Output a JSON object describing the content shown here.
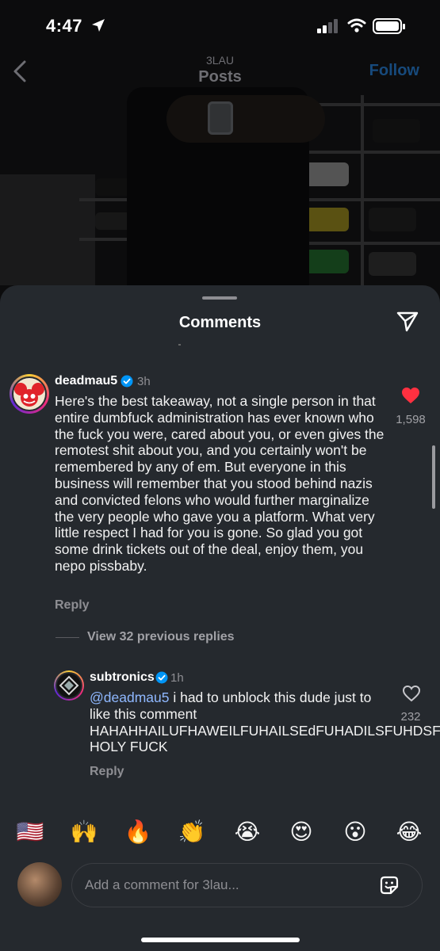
{
  "status_bar": {
    "time": "4:47"
  },
  "header": {
    "username": "3LAU",
    "title": "Posts",
    "follow_label": "Follow"
  },
  "sheet": {
    "title": "Comments"
  },
  "comments": [
    {
      "username": "deadmau5",
      "verified": true,
      "time": "3h",
      "text": "Here's the best takeaway, not a single person in that entire dumbfuck administration has ever known who the fuck you were, cared about you, or even gives the remotest shit about you, and you certainly won't be remembered by any of em. But everyone in this business will remember that you stood behind nazis and convicted felons who would further marginalize the very people who gave you a platform. What very little respect I had for you is gone.  So glad you got some drink tickets out of the deal, enjoy them, you nepo pissbaby.",
      "reply_label": "Reply",
      "likes": "1,598",
      "liked": true,
      "view_replies_label": "View 32 previous replies"
    },
    {
      "username": "subtronics",
      "verified": true,
      "time": "1h",
      "mention": "@deadmau5",
      "text": " i had to unblock this dude just to like this comment HAHAHHAILUFHAWEILFUHAILSEdFUHADILSFUHDSF HOLY FUCK",
      "reply_label": "Reply",
      "likes": "232",
      "liked": false
    }
  ],
  "emoji_bar": [
    "🇺🇸",
    "🙌",
    "🔥",
    "👏",
    "😭",
    "😍",
    "😮",
    "😂"
  ],
  "composer": {
    "placeholder": "Add a comment for 3lau..."
  },
  "colors": {
    "sheet_bg": "#25292e",
    "like_red": "#ff3040",
    "verified_blue": "#0095f6",
    "follow_blue_dimmed": "#174a7c",
    "mention_blue": "#8fb8ff"
  }
}
